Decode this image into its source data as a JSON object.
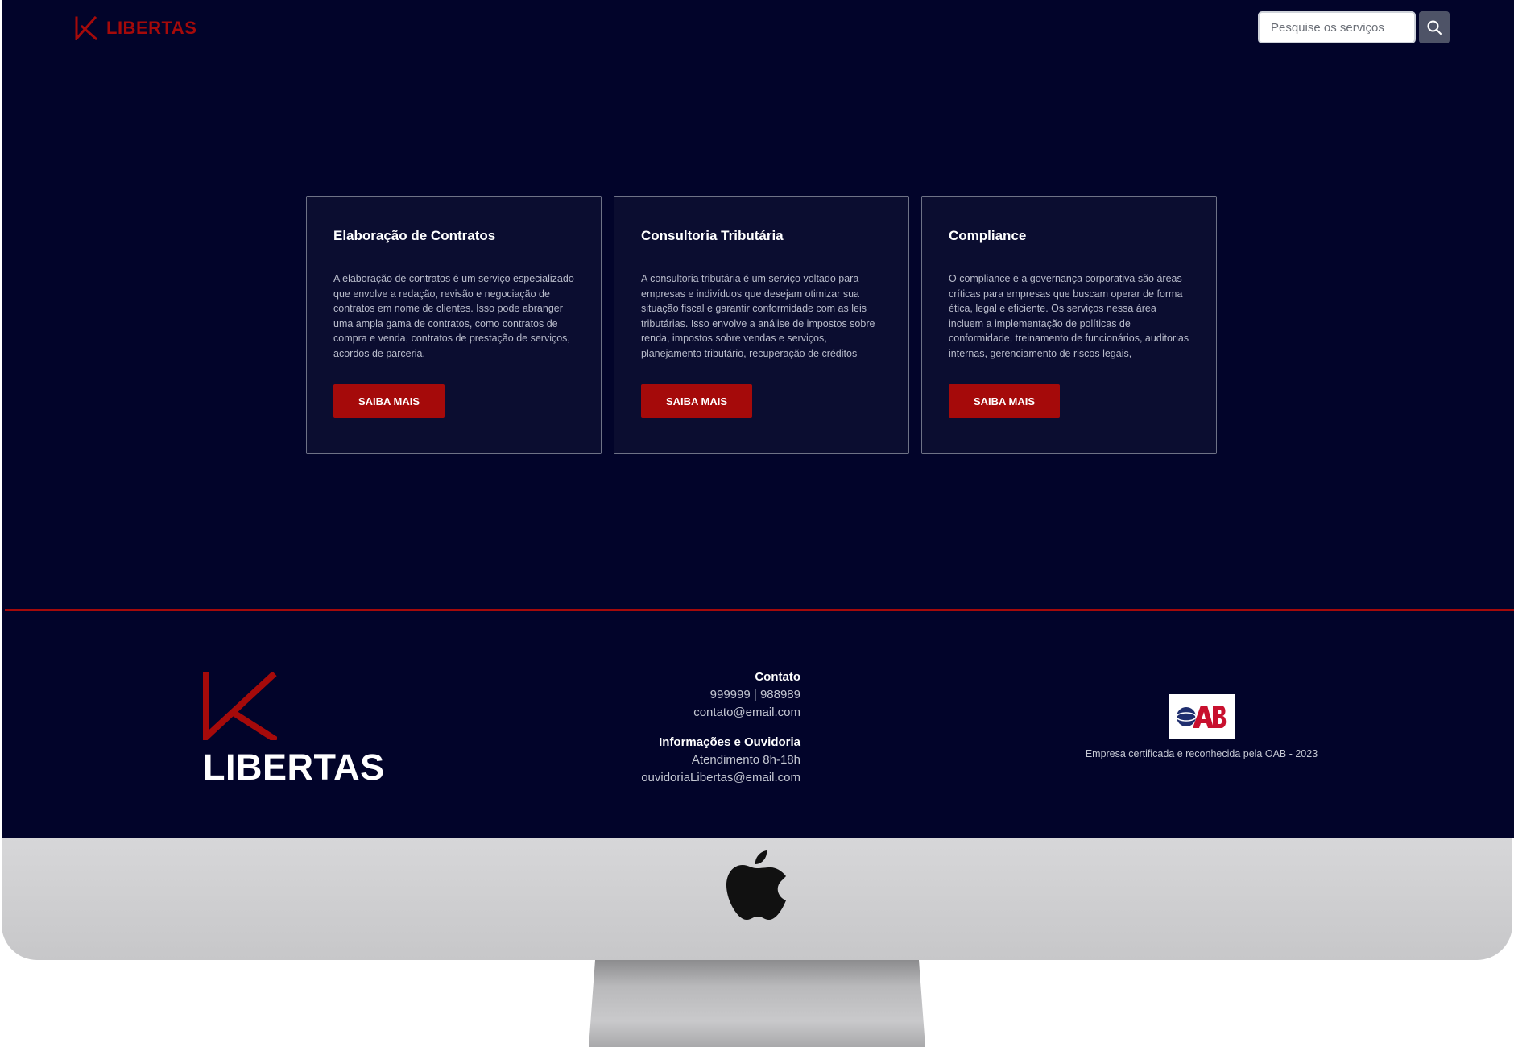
{
  "header": {
    "brand_name": "LIBERTAS",
    "search": {
      "placeholder": "Pesquise os serviços",
      "value": "",
      "button_icon": "search-icon"
    }
  },
  "services": [
    {
      "title": "Elaboração de Contratos",
      "description": "A elaboração de contratos é um serviço especializado que envolve a redação, revisão e negociação de contratos em nome de clientes. Isso pode abranger uma ampla gama de contratos, como contratos de compra e venda, contratos de prestação de serviços, acordos de parceria,",
      "button_label": "SAIBA MAIS"
    },
    {
      "title": "Consultoria Tributária",
      "description": "A consultoria tributária é um serviço voltado para empresas e indivíduos que desejam otimizar sua situação fiscal e garantir conformidade com as leis tributárias. Isso envolve a análise de impostos sobre renda, impostos sobre vendas e serviços, planejamento tributário, recuperação de créditos",
      "button_label": "SAIBA MAIS"
    },
    {
      "title": "Compliance",
      "description": "O compliance e a governança corporativa são áreas críticas para empresas que buscam operar de forma ética, legal e eficiente. Os serviços nessa área incluem a implementação de políticas de conformidade, treinamento de funcionários, auditorias internas, gerenciamento de riscos legais,",
      "button_label": "SAIBA MAIS"
    }
  ],
  "footer": {
    "brand_name": "LIBERTAS",
    "contact": {
      "heading": "Contato",
      "phones": "999999 | 988989",
      "email": "contato@email.com"
    },
    "ombudsman": {
      "heading": "Informações e Ouvidoria",
      "hours": "Atendimento 8h-18h",
      "email": "ouvidoriaLibertas@email.com"
    },
    "certification": {
      "badge_text": "OAB",
      "text": "Empresa certificada e reconhecida pela OAB - 2023"
    }
  },
  "colors": {
    "background": "#02042a",
    "card_background": "#0b0d30",
    "accent": "#a50a0a",
    "search_button": "#4e5367"
  }
}
